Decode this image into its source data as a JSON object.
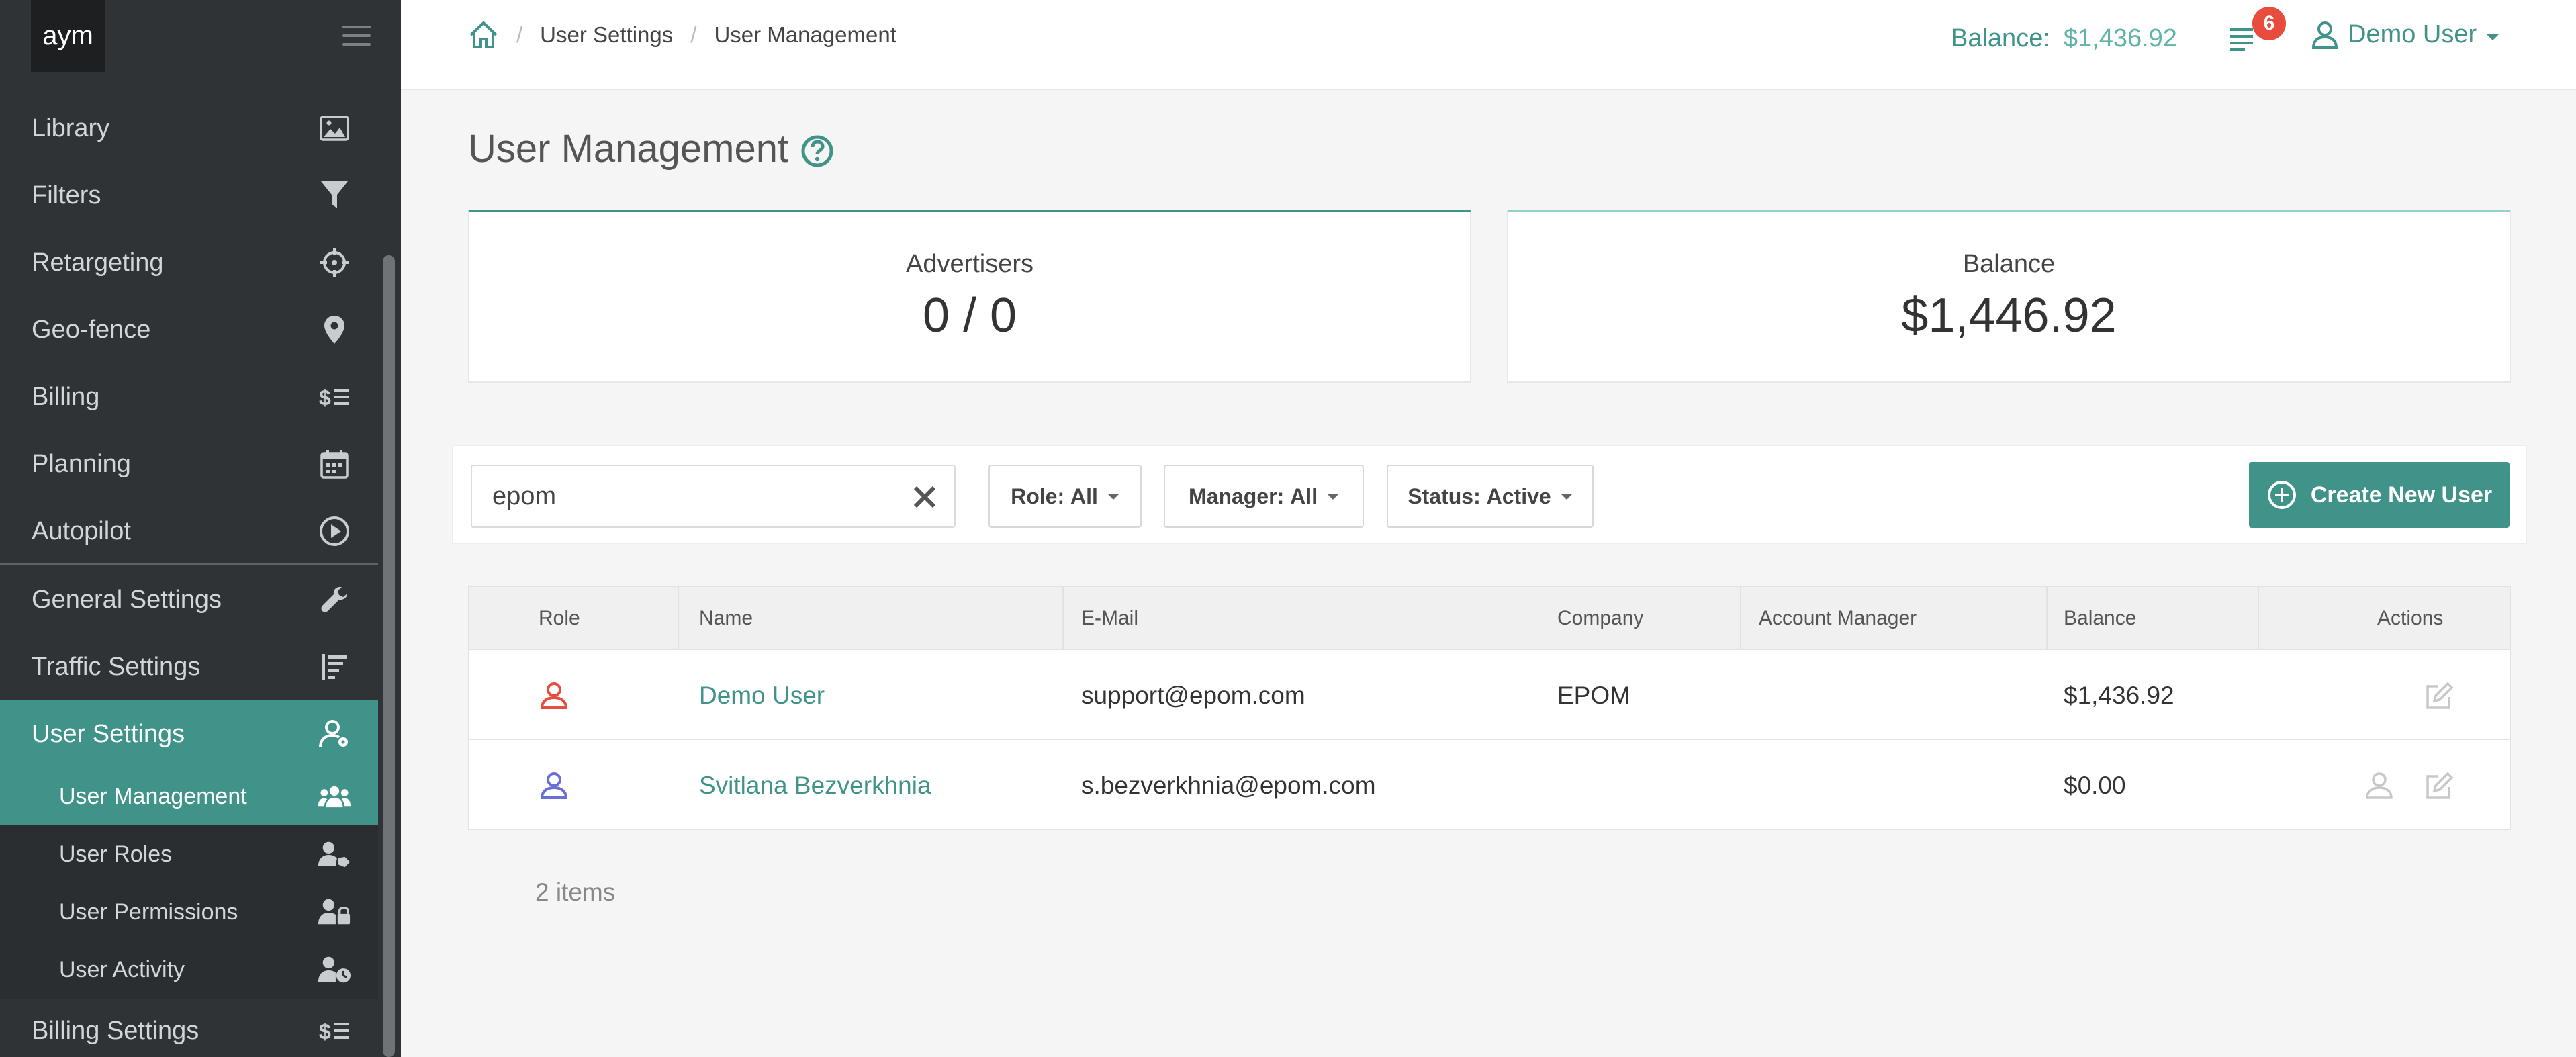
{
  "sidebar": {
    "logo": "aym",
    "items": [
      {
        "label": "Library",
        "icon": "image-icon"
      },
      {
        "label": "Filters",
        "icon": "funnel-icon"
      },
      {
        "label": "Retargeting",
        "icon": "crosshair-icon"
      },
      {
        "label": "Geo-fence",
        "icon": "map-pin-icon"
      },
      {
        "label": "Billing",
        "icon": "dollar-list-icon"
      },
      {
        "label": "Planning",
        "icon": "calendar-icon"
      },
      {
        "label": "Autopilot",
        "icon": "play-circle-icon"
      },
      {
        "label": "General Settings",
        "icon": "wrench-icon"
      },
      {
        "label": "Traffic Settings",
        "icon": "sort-lines-icon"
      },
      {
        "label": "User Settings",
        "icon": "user-cog-icon"
      }
    ],
    "sub_items": [
      {
        "label": "User Management",
        "icon": "users-group-icon"
      },
      {
        "label": "User Roles",
        "icon": "user-tag-icon"
      },
      {
        "label": "User Permissions",
        "icon": "user-lock-icon"
      },
      {
        "label": "User Activity",
        "icon": "user-clock-icon"
      }
    ],
    "footer_item": {
      "label": "Billing Settings",
      "icon": "dollar-list-icon"
    }
  },
  "header": {
    "breadcrumb": [
      "User Settings",
      "User Management"
    ],
    "balance_label": "Balance:",
    "balance_value": "$1,436.92",
    "notifications_count": "6",
    "user_name": "Demo User"
  },
  "page": {
    "title": "User Management"
  },
  "stats": {
    "advertisers_label": "Advertisers",
    "advertisers_value": "0 / 0",
    "balance_label": "Balance",
    "balance_value": "$1,446.92"
  },
  "filters": {
    "search_value": "epom",
    "role_prefix": "Role:",
    "role_value": "All",
    "manager_prefix": "Manager:",
    "manager_value": "All",
    "status_prefix": "Status:",
    "status_value": "Active",
    "create_label": "Create New User"
  },
  "table": {
    "columns": [
      "Role",
      "Name",
      "E-Mail",
      "Company",
      "Account Manager",
      "Balance",
      "Actions"
    ],
    "rows": [
      {
        "role_color": "#e74c3c",
        "name": "Demo User",
        "email": "support@epom.com",
        "company": "EPOM",
        "account_manager": "",
        "balance": "$1,436.92"
      },
      {
        "role_color": "#6a6fd6",
        "name": "Svitlana Bezverkhnia",
        "email": "s.bezverkhnia@epom.com",
        "company": "",
        "account_manager": "",
        "balance": "$0.00"
      }
    ],
    "items_count": "2 items"
  },
  "colors": {
    "accent": "#3f9388",
    "sidebar_bg": "#2f3336",
    "badge": "#e74c3c"
  }
}
